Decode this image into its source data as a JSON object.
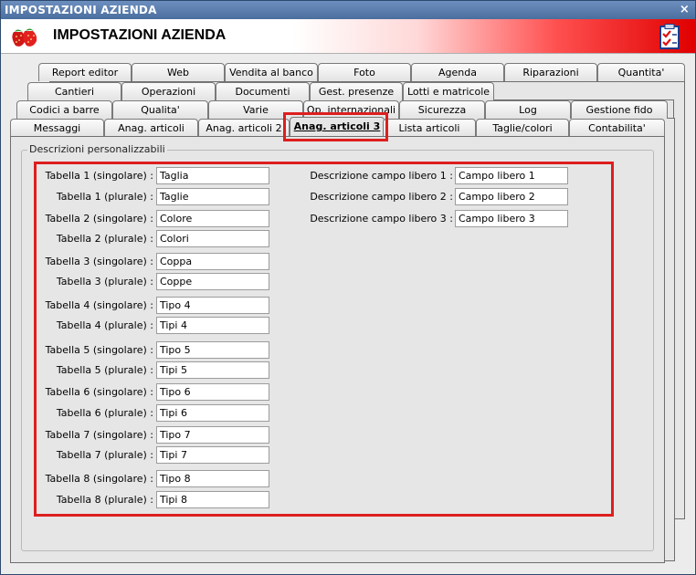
{
  "window": {
    "title": "IMPOSTAZIONI AZIENDA",
    "close_glyph": "×"
  },
  "header": {
    "title": "IMPOSTAZIONI AZIENDA",
    "logo_icon": "strawberries-icon",
    "action_icon": "checklist-icon"
  },
  "tabs": {
    "row1": [
      "Report editor",
      "Web",
      "Vendita al banco",
      "Foto",
      "Agenda",
      "Riparazioni",
      "Quantita'"
    ],
    "row2": [
      "Cantieri",
      "Operazioni",
      "Documenti",
      "Gest. presenze",
      "Lotti e matricole"
    ],
    "row3": [
      "Codici a barre",
      "Qualita'",
      "Varie",
      "Op. internazionali",
      "Sicurezza",
      "Log",
      "Gestione fido"
    ],
    "row4": [
      "Messaggi",
      "Anag. articoli",
      "Anag. articoli 2",
      "Anag. articoli 3",
      "Lista articoli",
      "Taglie/colori",
      "Contabilita'"
    ],
    "active": "Anag. articoli 3"
  },
  "group": {
    "title": "Descrizioni personalizzabili"
  },
  "tabelle": [
    {
      "label": "Tabella 1 (singolare) :",
      "value": "Taglia"
    },
    {
      "label": "Tabella 1 (plurale) :",
      "value": "Taglie"
    },
    {
      "label": "Tabella 2 (singolare) :",
      "value": "Colore"
    },
    {
      "label": "Tabella 2 (plurale) :",
      "value": "Colori"
    },
    {
      "label": "Tabella 3 (singolare) :",
      "value": "Coppa"
    },
    {
      "label": "Tabella 3 (plurale) :",
      "value": "Coppe"
    },
    {
      "label": "Tabella 4 (singolare) :",
      "value": "Tipo 4"
    },
    {
      "label": "Tabella 4 (plurale) :",
      "value": "Tipi 4"
    },
    {
      "label": "Tabella 5 (singolare) :",
      "value": "Tipo 5"
    },
    {
      "label": "Tabella 5 (plurale) :",
      "value": "Tipi 5"
    },
    {
      "label": "Tabella 6 (singolare) :",
      "value": "Tipo 6"
    },
    {
      "label": "Tabella 6 (plurale) :",
      "value": "Tipi 6"
    },
    {
      "label": "Tabella 7 (singolare) :",
      "value": "Tipo 7"
    },
    {
      "label": "Tabella 7 (plurale) :",
      "value": "Tipi 7"
    },
    {
      "label": "Tabella 8 (singolare) :",
      "value": "Tipo 8"
    },
    {
      "label": "Tabella 8 (plurale) :",
      "value": "Tipi 8"
    }
  ],
  "campi_liberi": [
    {
      "label": "Descrizione campo libero 1 :",
      "value": "Campo libero 1"
    },
    {
      "label": "Descrizione campo libero 2 :",
      "value": "Campo libero 2"
    },
    {
      "label": "Descrizione campo libero 3 :",
      "value": "Campo libero 3"
    }
  ],
  "colors": {
    "highlight": "#dd1f1f",
    "title_bar": "#5a7dad",
    "header_red": "#e00000"
  }
}
